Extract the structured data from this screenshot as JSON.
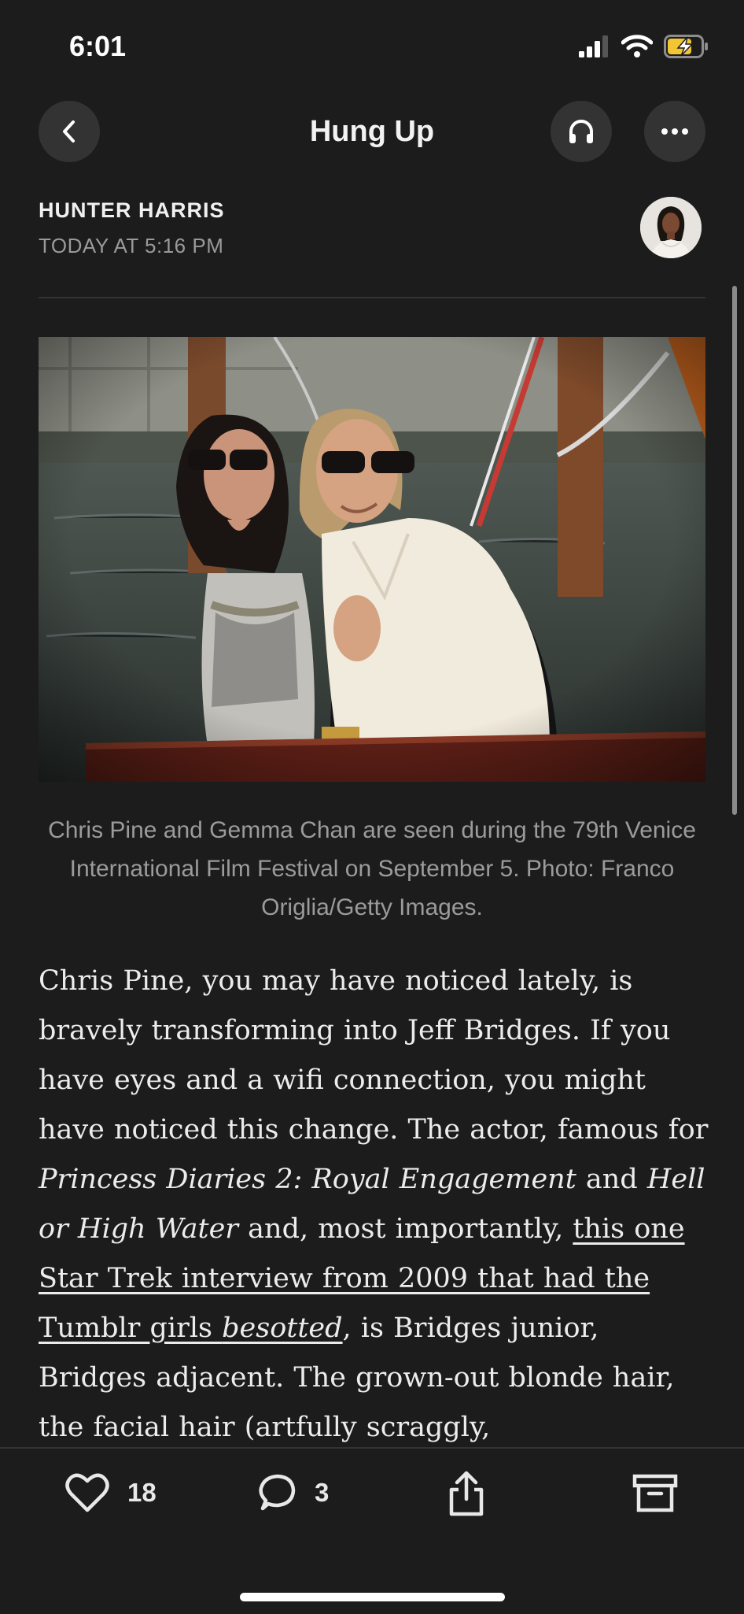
{
  "status_bar": {
    "time": "6:01"
  },
  "nav": {
    "title": "Hung Up",
    "back_icon": "chevron-left-icon",
    "listen_icon": "headphones-icon",
    "more_icon": "ellipsis-icon"
  },
  "article": {
    "author": "HUNTER HARRIS",
    "date": "TODAY AT 5:16 PM",
    "caption": "Chris Pine and Gemma Chan are seen during the 79th Venice International Film Festival on September 5. Photo: Franco Origlia/Getty Images.",
    "body": {
      "p1": "Chris Pine, you may have noticed lately, is bravely transforming into Jeff Bridges. If you have eyes and a wifi connection, you might have noticed this change. The actor, famous for ",
      "em1": "Princess Diaries 2: Royal Engagement",
      "p2": " and ",
      "em2": "Hell or High Water",
      "p3": " and, most importantly, ",
      "link_text": "this one Star Trek interview from 2009 that had the Tumblr girls ",
      "link_em": "besotted",
      "p4": ", is Bridges junior, Bridges adjacent. The grown-out blonde hair, the facial hair (artfully scraggly,"
    }
  },
  "toolbar": {
    "likes": "18",
    "comments": "3",
    "like_icon": "heart-icon",
    "comment_icon": "comment-bubble-icon",
    "share_icon": "share-icon",
    "archive_icon": "archive-icon"
  },
  "colors": {
    "background": "#1c1c1c",
    "button_bg": "#333333",
    "battery_charging": "#f3c533"
  }
}
